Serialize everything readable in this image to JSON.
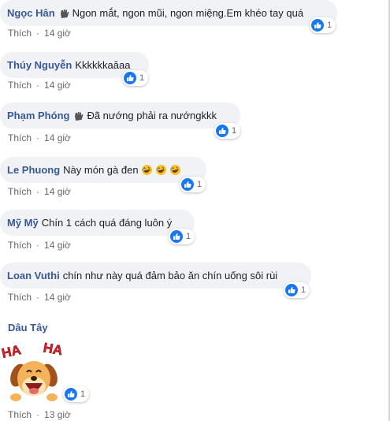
{
  "colors": {
    "author": "#385898",
    "bubble": "#f0f2f5",
    "meta": "#65676b",
    "like": "#1877f2"
  },
  "comments": [
    {
      "author": "Ngọc Hân",
      "hand": true,
      "text": "Ngon mắt, ngon mũi, ngon miệng.Em khéo tay quá",
      "like": "Thích",
      "time": "14 giờ",
      "reactions": "1"
    },
    {
      "author": "Thúy Nguyễn",
      "hand": false,
      "text": "Kkkkkkaăaa",
      "like": "Thích",
      "time": "14 giờ",
      "reactions": "1"
    },
    {
      "author": "Phạm Phóng",
      "hand": true,
      "text": "Đã nướng phải ra nướngkkk",
      "like": "Thích",
      "time": "14 giờ",
      "reactions": "1"
    },
    {
      "author": "Le Phuong",
      "hand": false,
      "text": "Này món gà đen",
      "emoji": [
        "rofl-emoji",
        "rofl-emoji",
        "rofl-emoji"
      ],
      "like": "Thích",
      "time": "14 giờ",
      "reactions": "1"
    },
    {
      "author": "Mỹ Mỹ",
      "hand": false,
      "text": "Chín 1 cách quá đáng luôn ý",
      "like": "Thích",
      "time": "14 giờ",
      "reactions": "1"
    },
    {
      "author": "Loan Vuthi",
      "hand": false,
      "text": "chín như này quá đảm bảo ăn chín uống sôi rùi",
      "like": "Thích",
      "time": "14 giờ",
      "reactions": "1"
    },
    {
      "author": "Dâu Tây",
      "sticker": "HA HA",
      "like": "Thích",
      "time": "13 giờ",
      "reactions": "1"
    }
  ]
}
